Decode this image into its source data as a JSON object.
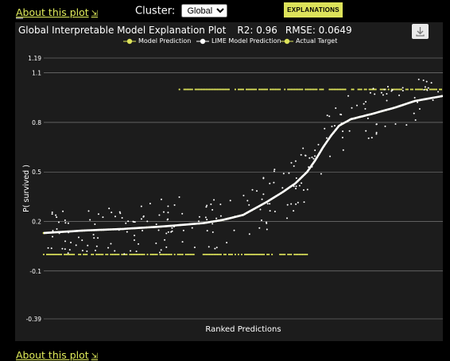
{
  "about": {
    "label": "About this plot",
    "arrow": "⇲"
  },
  "cluster": {
    "label": "Cluster:",
    "selected": "Global"
  },
  "explain_button": "EXPLANATIONS",
  "plot": {
    "title": "Global Interpretable Model Explanation Plot",
    "r2": "R2: 0.96",
    "rmse": "RMSE: 0.0649"
  },
  "colors": {
    "accent": "#dde35a",
    "prediction": "#ffffff",
    "target": "#dde35a",
    "panel": "#1c1c1c"
  },
  "icons": {
    "download": "download-icon"
  },
  "chart_data": {
    "type": "scatter",
    "title": "Global Interpretable Model Explanation Plot",
    "xlabel": "Ranked Predictions",
    "ylabel": "P( survived )",
    "ylim": [
      -0.39,
      1.19
    ],
    "yticks": [
      "1.19",
      "1.1",
      "0.8",
      "0.5",
      "0.2",
      "-0.1",
      "-0.39"
    ],
    "grid": true,
    "legend_position": "top",
    "series": [
      {
        "name": "Model Prediction",
        "color": "#dde35a",
        "style": "points"
      },
      {
        "name": "LIME Model Prediction",
        "color": "#ffffff",
        "style": "line"
      },
      {
        "name": "Actual Target",
        "color": "#dde35a",
        "style": "points"
      }
    ],
    "x_range": [
      0,
      1
    ],
    "lime_curve": [
      [
        0.0,
        0.13
      ],
      [
        0.1,
        0.145
      ],
      [
        0.2,
        0.155
      ],
      [
        0.3,
        0.17
      ],
      [
        0.4,
        0.19
      ],
      [
        0.45,
        0.21
      ],
      [
        0.5,
        0.24
      ],
      [
        0.53,
        0.28
      ],
      [
        0.56,
        0.32
      ],
      [
        0.6,
        0.38
      ],
      [
        0.63,
        0.43
      ],
      [
        0.66,
        0.5
      ],
      [
        0.68,
        0.57
      ],
      [
        0.7,
        0.65
      ],
      [
        0.72,
        0.72
      ],
      [
        0.74,
        0.78
      ],
      [
        0.77,
        0.82
      ],
      [
        0.82,
        0.85
      ],
      [
        0.88,
        0.89
      ],
      [
        0.93,
        0.93
      ],
      [
        1.0,
        0.96
      ]
    ],
    "actual_target": [
      {
        "value": 0,
        "x_range": [
          0.0,
          0.67
        ]
      },
      {
        "value": 1,
        "x_range": [
          0.34,
          1.0
        ]
      }
    ]
  }
}
